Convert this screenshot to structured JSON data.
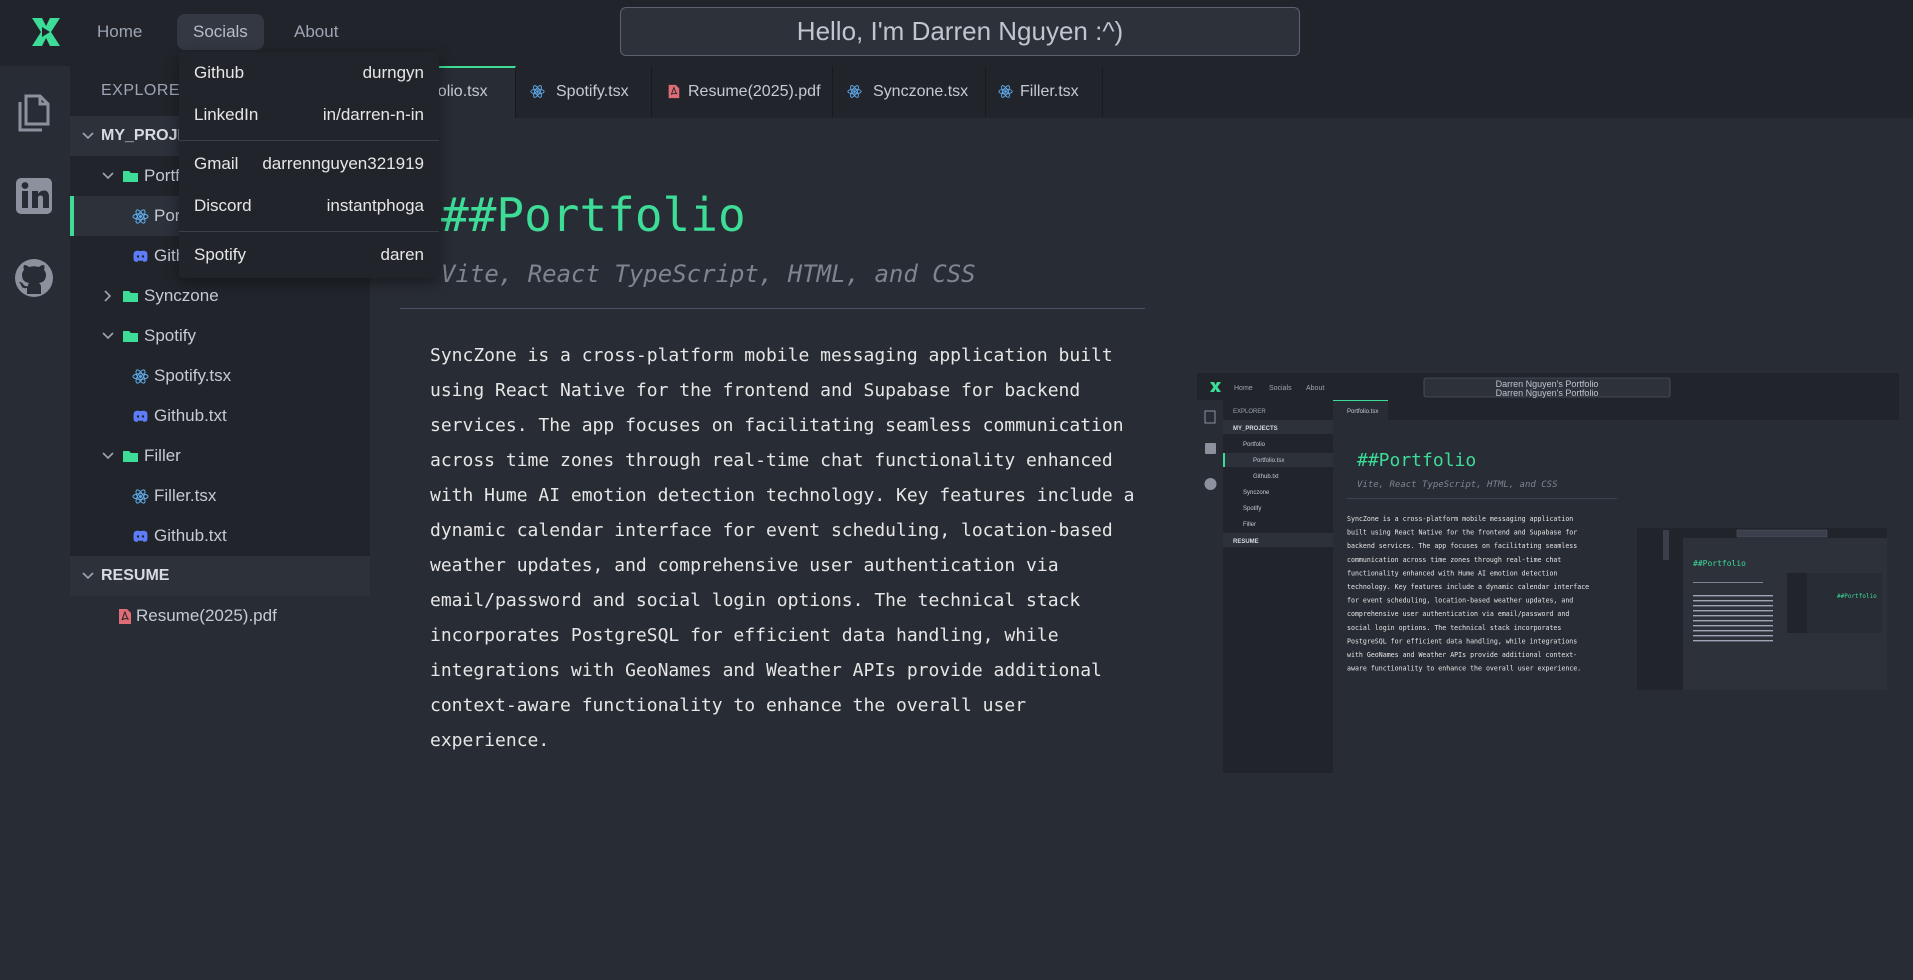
{
  "topbar": {
    "nav": {
      "home": "Home",
      "socials": "Socials",
      "about": "About"
    },
    "greeting": "Hello, I'm Darren Nguyen :^)"
  },
  "socials_menu": [
    {
      "name": "Github",
      "value": "durngyn"
    },
    {
      "name": "LinkedIn",
      "value": "in/darren-n-in"
    },
    {
      "name": "Gmail",
      "value": "darrennguyen321919"
    },
    {
      "name": "Discord",
      "value": "instantphoga"
    },
    {
      "name": "Spotify",
      "value": "daren"
    }
  ],
  "sidebar": {
    "title": "EXPLORER",
    "tree": {
      "projects": "MY_PROJECTS",
      "portfolio_folder": "Portfolio",
      "portfolio_file": "Portfolio.tsx",
      "portfolio_github": "Github.txt",
      "synczone_folder": "Synczone",
      "spotify_folder": "Spotify",
      "spotify_file": "Spotify.tsx",
      "spotify_github": "Github.txt",
      "filler_folder": "Filler",
      "filler_file": "Filler.tsx",
      "filler_github": "Github.txt",
      "resume_section": "RESUME",
      "resume_file": "Resume(2025).pdf"
    }
  },
  "tabs": [
    "Portfolio.tsx",
    "Spotify.tsx",
    "Resume(2025).pdf",
    "Synczone.tsx",
    "Filler.tsx"
  ],
  "content": {
    "heading": "##Portfolio",
    "subtitle": "Vite, React TypeScript, HTML, and CSS",
    "paragraph": "SyncZone is a cross-platform mobile messaging application built using React Native for the frontend and Supabase for backend services. The app focuses on facilitating seamless communication across time zones through real-time chat functionality enhanced with Hume AI emotion detection technology. Key features include a dynamic calendar interface for event scheduling, location-based weather updates, and comprehensive user authentication via email/password and social login options. The technical stack incorporates PostgreSQL for efficient data handling, while integrations with GeoNames and Weather APIs provide additional context-aware functionality to enhance the overall user experience."
  },
  "preview": {
    "nav": {
      "home": "Home",
      "socials": "Socials",
      "about": "About"
    },
    "title": "Darren Nguyen's Portfolio",
    "explorer": "EXPLORER",
    "projects": "MY_PROJECTS",
    "portfolio": "Portfolio",
    "portfolio_file": "Portfolio.tsx",
    "github": "Github.txt",
    "synczone": "Synczone",
    "spotify": "Spotify",
    "filler": "Filler",
    "resume": "RESUME",
    "tab": "Portfolio.tsx",
    "heading": "##Portfolio",
    "subtitle": "Vite, React TypeScript, HTML, and CSS",
    "lines": [
      "SyncZone is a cross-platform mobile messaging application",
      "built using React Native for the frontend and Supabase for",
      "backend services. The app focuses on facilitating seamless",
      "communication across time zones through real-time chat",
      "functionality enhanced with Hume AI emotion detection",
      "technology. Key features include a dynamic calendar interface",
      "for event scheduling, location-based weather updates, and",
      "comprehensive user authentication via email/password and",
      "social login options. The technical stack incorporates",
      "PostgreSQL for efficient data handling, while integrations",
      "with GeoNames and Weather APIs provide additional context-",
      "aware functionality to enhance the overall user experience."
    ]
  },
  "colors": {
    "accent": "#3ddc97",
    "background": "#282c34",
    "panel": "#21252b",
    "react_icon": "#61afef",
    "pdf_icon": "#e06c75",
    "github_icon": "#5c7cfa"
  }
}
